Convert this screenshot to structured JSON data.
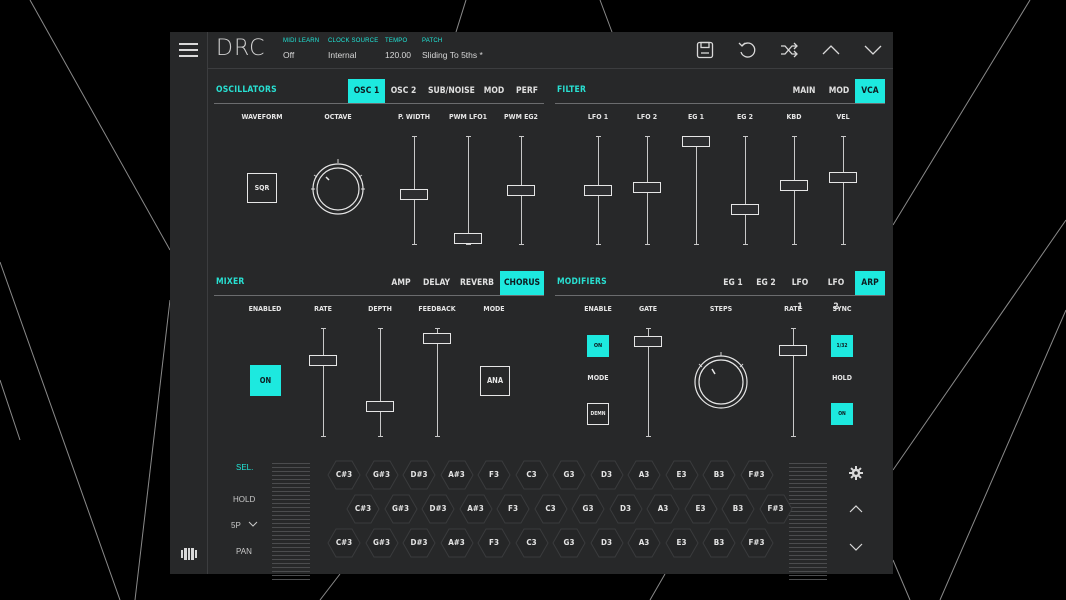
{
  "app": {
    "logo": "DRC"
  },
  "topbar": {
    "midi_learn": {
      "label": "MIDI LEARN",
      "value": "Off"
    },
    "clock_source": {
      "label": "CLOCK SOURCE",
      "value": "Internal"
    },
    "tempo": {
      "label": "TEMPO",
      "value": "120.00"
    },
    "patch": {
      "label": "PATCH",
      "value": "Sliding To 5ths *"
    },
    "icons": [
      "save-icon",
      "undo-icon",
      "shuffle-icon",
      "chevron-up-icon",
      "chevron-down-icon"
    ]
  },
  "oscillators": {
    "title": "OSCILLATORS",
    "tabs": [
      "OSC 1",
      "OSC 2",
      "SUB/NOISE",
      "MOD",
      "PERF"
    ],
    "active_tab": "OSC 1",
    "params": {
      "waveform": "WAVEFORM",
      "octave": "OCTAVE",
      "pwidth": "P. WIDTH",
      "pwm_lfo1": "PWM LFO1",
      "pwm_eg2": "PWM EG2"
    },
    "waveform_value": "SQR",
    "sliders": {
      "pwidth": 0.45,
      "pwm_lfo1": 0.0,
      "pwm_eg2": 0.5
    }
  },
  "filter": {
    "title": "FILTER",
    "tabs": [
      "MAIN",
      "MOD",
      "VCA"
    ],
    "active_tab": "VCA",
    "params": {
      "lfo1": "LFO 1",
      "lfo2": "LFO 2",
      "eg1": "EG 1",
      "eg2": "EG 2",
      "kbd": "KBD",
      "vel": "VEL"
    },
    "sliders": {
      "lfo1": 0.5,
      "lfo2": 0.53,
      "eg1": 1.0,
      "eg2": 0.3,
      "kbd": 0.55,
      "vel": 0.63
    }
  },
  "mixer": {
    "title": "MIXER",
    "tabs": [
      "AMP",
      "DELAY",
      "REVERB",
      "CHORUS"
    ],
    "active_tab": "CHORUS",
    "params": {
      "enabled": "ENABLED",
      "rate": "RATE",
      "depth": "DEPTH",
      "feedback": "FEEDBACK",
      "mode": "MODE"
    },
    "enabled_value": "ON",
    "mode_value": "ANA",
    "sliders": {
      "rate": 0.72,
      "depth": 0.25,
      "feedback": 0.95
    }
  },
  "modifiers": {
    "title": "MODIFIERS",
    "tabs": [
      "EG 1",
      "EG 2",
      "LFO 1",
      "LFO 2",
      "ARP"
    ],
    "active_tab": "ARP",
    "params": {
      "enable": "ENABLE",
      "gate": "GATE",
      "steps": "STEPS",
      "rate": "RATE",
      "sync": "SYNC",
      "mode": "MODE",
      "hold": "HOLD"
    },
    "enable_value": "ON",
    "mode_value": "DEMN",
    "sync_value": "1/32",
    "hold_value": "ON",
    "sliders": {
      "gate": 0.92,
      "rate": 0.82
    }
  },
  "keyboard": {
    "side": {
      "sel": "SEL.",
      "hold": "HOLD",
      "sp": "5P",
      "pan": "PAN"
    },
    "rows": [
      [
        "C#3",
        "G#3",
        "D#3",
        "A#3",
        "F3",
        "C3",
        "G3",
        "D3",
        "A3",
        "E3",
        "B3",
        "F#3"
      ],
      [
        "C#3",
        "G#3",
        "D#3",
        "A#3",
        "F3",
        "C3",
        "G3",
        "D3",
        "A3",
        "E3",
        "B3",
        "F#3"
      ],
      [
        "C#3",
        "G#3",
        "D#3",
        "A#3",
        "F3",
        "C3",
        "G3",
        "D3",
        "A3",
        "E3",
        "B3",
        "F#3"
      ]
    ]
  },
  "colors": {
    "accent": "#1de9df",
    "panel": "#272829",
    "background": "#000000",
    "text": "#e6e6e6"
  }
}
